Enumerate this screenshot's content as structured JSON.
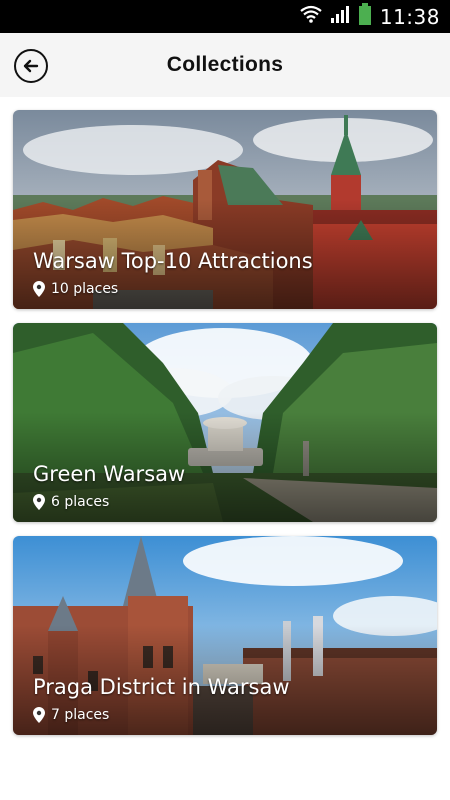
{
  "status_bar": {
    "time": "11:38",
    "icons": [
      "wifi-icon",
      "cell-signal-icon",
      "battery-icon"
    ],
    "battery_color": "#4caf50"
  },
  "header": {
    "title": "Collections",
    "back_icon": "arrow-left-circle-icon"
  },
  "collections": [
    {
      "title": "Warsaw Top-10 Attractions",
      "places": "10 places",
      "pin_icon": "location-pin-icon"
    },
    {
      "title": "Green Warsaw",
      "places": "6 places",
      "pin_icon": "location-pin-icon"
    },
    {
      "title": "Praga District in Warsaw",
      "places": "7 places",
      "pin_icon": "location-pin-icon"
    }
  ]
}
